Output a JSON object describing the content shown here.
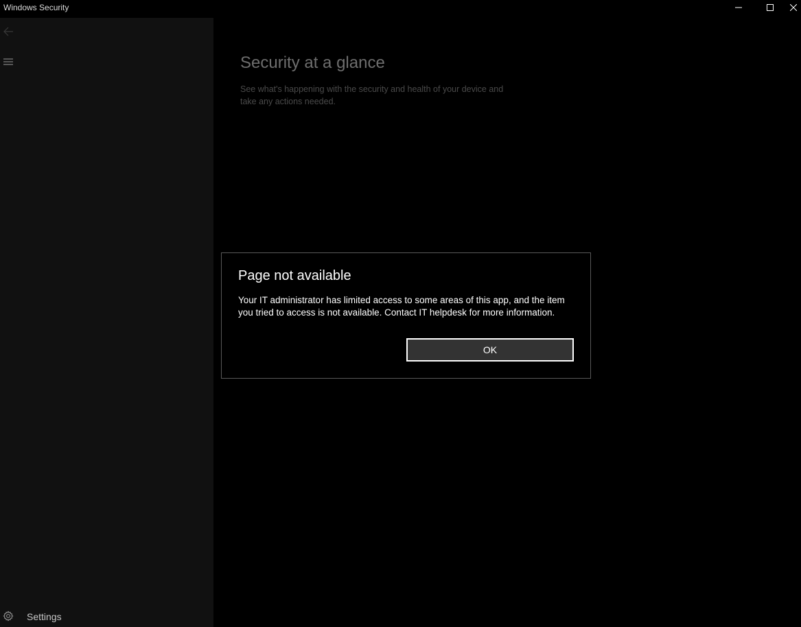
{
  "window": {
    "title": "Windows Security"
  },
  "sidebar": {
    "back_icon": "arrow-left-icon",
    "menu_icon": "hamburger-icon",
    "settings": {
      "icon": "gear-icon",
      "label": "Settings"
    }
  },
  "main": {
    "title": "Security at a glance",
    "subtitle": "See what's happening with the security and health of your device and take any actions needed."
  },
  "dialog": {
    "title": "Page not available",
    "message": "Your IT administrator has limited access to some areas of this app, and the item you tried to access is not available. Contact IT helpdesk for more information.",
    "ok_label": "OK"
  },
  "colors": {
    "background": "#000000",
    "sidebar": "#111111",
    "button": "#333333",
    "dialog_border": "#5a5a5a"
  }
}
